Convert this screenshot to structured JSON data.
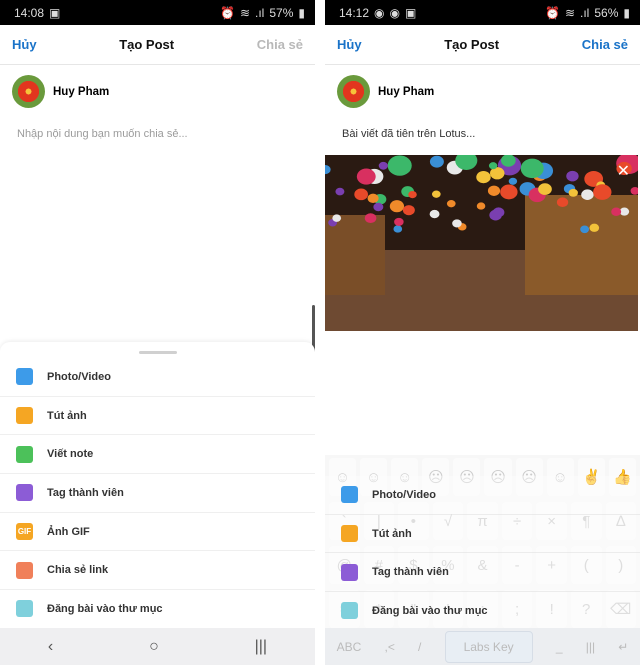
{
  "left": {
    "status": {
      "time": "14:08",
      "battery": "57%"
    },
    "header": {
      "cancel": "Hủy",
      "title": "Tạo Post",
      "share": "Chia sẻ"
    },
    "user": {
      "name": "Huy Pham"
    },
    "post": {
      "placeholder": "Nhập nội dung bạn muốn chia sẻ...",
      "value": ""
    },
    "menu": [
      {
        "label": "Photo/Video",
        "icon": "camera-icon",
        "color": "#3d9be9"
      },
      {
        "label": "Tút ảnh",
        "icon": "image-icon",
        "color": "#f5a623"
      },
      {
        "label": "Viết note",
        "icon": "note-icon",
        "color": "#4cc15a"
      },
      {
        "label": "Tag thành viên",
        "icon": "user-tag-icon",
        "color": "#8c5cd6"
      },
      {
        "label": "Ảnh GIF",
        "icon": "gif-icon",
        "color": "#f5a623",
        "glyph": "GIF"
      },
      {
        "label": "Chia sẻ link",
        "icon": "link-icon",
        "color": "#f0805a"
      },
      {
        "label": "Đăng bài vào thư mục",
        "icon": "folder-icon",
        "color": "#7fd0dc"
      }
    ]
  },
  "right": {
    "status": {
      "time": "14:12",
      "battery": "56%"
    },
    "header": {
      "cancel": "Hủy",
      "title": "Tạo Post",
      "share": "Chia sẻ"
    },
    "user": {
      "name": "Huy Pham"
    },
    "post": {
      "value": "Bài viết đã tiên trên Lotus..."
    },
    "menu": [
      {
        "label": "Photo/Video",
        "icon": "camera-icon",
        "color": "#3d9be9"
      },
      {
        "label": "Tút ảnh",
        "icon": "image-icon",
        "color": "#f5a623"
      },
      {
        "label": "Tag thành viên",
        "icon": "user-tag-icon",
        "color": "#8c5cd6"
      },
      {
        "label": "Đăng bài vào thư mục",
        "icon": "folder-icon",
        "color": "#7fd0dc"
      }
    ],
    "keyboard": {
      "rows": [
        [
          "☺",
          "☺",
          "☺",
          "☹",
          "☹",
          "☹",
          "☹",
          "☺",
          "✌",
          "👍"
        ],
        [
          "`",
          "|",
          "•",
          "√",
          "π",
          "÷",
          "×",
          "¶",
          "∆"
        ],
        [
          "@",
          "#",
          "$",
          "%",
          "&",
          "-",
          "+",
          "(",
          ")"
        ],
        [
          "=",
          "*",
          "\"",
          "'",
          ":",
          ";",
          "!",
          "?",
          "⌫"
        ]
      ],
      "bottom": {
        "abc": "ABC",
        "comma": ",<",
        "slash": "/",
        "space": "Labs Key",
        "underscore": "_",
        "enter": "↵"
      }
    }
  },
  "nav": {
    "back": "‹",
    "home": "○",
    "recents": "|||"
  }
}
